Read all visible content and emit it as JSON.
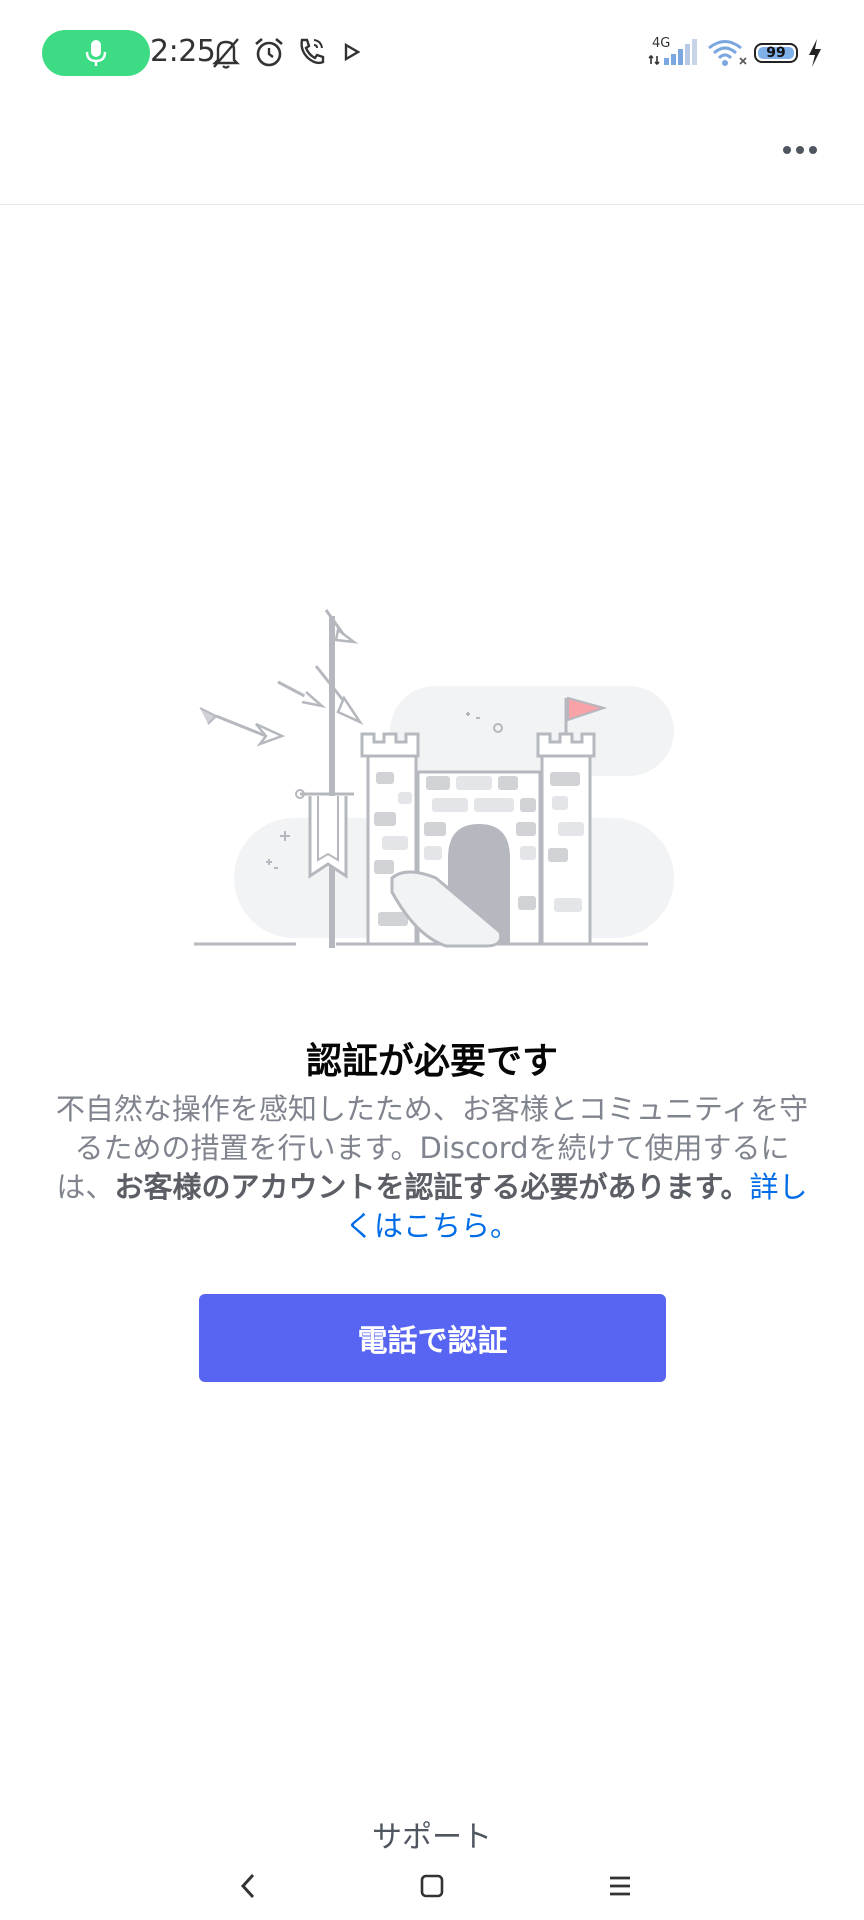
{
  "status_bar": {
    "time": "2:25",
    "network_label": "4G",
    "battery_level": "99",
    "icons": [
      "microphone-icon",
      "bell-off-icon",
      "alarm-icon",
      "wifi-calling-icon",
      "play-icon",
      "signal-icon",
      "wifi-icon",
      "battery-icon",
      "charging-icon"
    ],
    "mic_color": "#3ddc84"
  },
  "header": {
    "more_icon": "more-horizontal-icon"
  },
  "main": {
    "illustration": "castle-illustration",
    "title": "認証が必要です",
    "body_part1": "不自然な操作を感知したため、お客様とコミュニティを守るための措置を行います。Discordを続けて使用するには、",
    "body_bold": "お客様のアカウントを認証する必要があります。",
    "learn_more_link": "詳しくはこちら。",
    "verify_button_label": "電話で認証"
  },
  "footer": {
    "support_label": "サポート"
  },
  "nav_bar": {
    "back_icon": "back-icon",
    "home_icon": "home-icon",
    "menu_icon": "menu-icon"
  },
  "colors": {
    "accent": "#5865f2",
    "link": "#006ce7",
    "title": "#060607",
    "body": "#80848e",
    "flag": "#f7a3a8"
  }
}
